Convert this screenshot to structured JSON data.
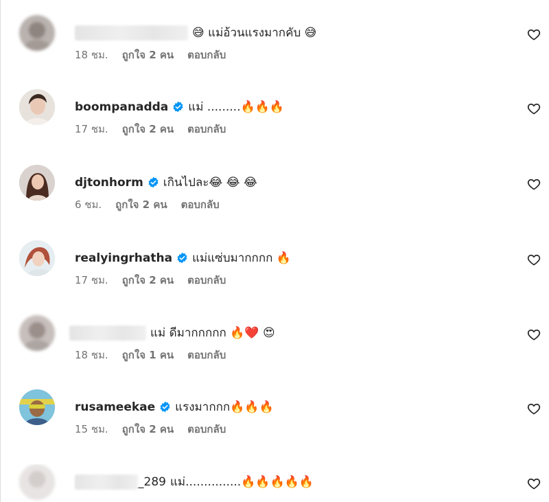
{
  "comments": [
    {
      "username": "",
      "username_blurred": true,
      "verified": false,
      "text": "😅 แม่อ้วนแรงมากคับ 😅",
      "time": "18 ชม.",
      "likes": "ถูกใจ 2 คน",
      "reply": "ตอบกลับ"
    },
    {
      "username": "boompanadda",
      "username_blurred": false,
      "verified": true,
      "text": "แม่ .........🔥🔥🔥",
      "time": "17 ชม.",
      "likes": "ถูกใจ 2 คน",
      "reply": "ตอบกลับ"
    },
    {
      "username": "djtonhorm",
      "username_blurred": false,
      "verified": true,
      "text": "เกินไปละ😂 😂 😂",
      "time": "6 ชม.",
      "likes": "ถูกใจ 2 คน",
      "reply": "ตอบกลับ"
    },
    {
      "username": "realyingrhatha",
      "username_blurred": false,
      "verified": true,
      "text": "แม่แซ่บมากกกก 🔥",
      "time": "17 ชม.",
      "likes": "ถูกใจ 2 คน",
      "reply": "ตอบกลับ"
    },
    {
      "username": "",
      "username_blurred": true,
      "verified": false,
      "text": "แม่ ดีมากกกกก 🔥❤️ 😍",
      "time": "18 ชม.",
      "likes": "ถูกใจ 1 คน",
      "reply": "ตอบกลับ"
    },
    {
      "username": "rusameekae",
      "username_blurred": false,
      "verified": true,
      "text": "แรงมากกก🔥🔥🔥",
      "time": "15 ชม.",
      "likes": "ถูกใจ 2 คน",
      "reply": "ตอบกลับ"
    },
    {
      "username": "_289",
      "username_blurred": true,
      "verified": false,
      "text": "แม่...............🔥🔥🔥🔥🔥",
      "time": "",
      "likes": "",
      "reply": ""
    }
  ],
  "colors": {
    "text": "#262626",
    "secondary": "#737373",
    "verified": "#0095f6"
  },
  "icons": {
    "like": "heart-outline-icon",
    "verified": "verified-badge-icon"
  }
}
